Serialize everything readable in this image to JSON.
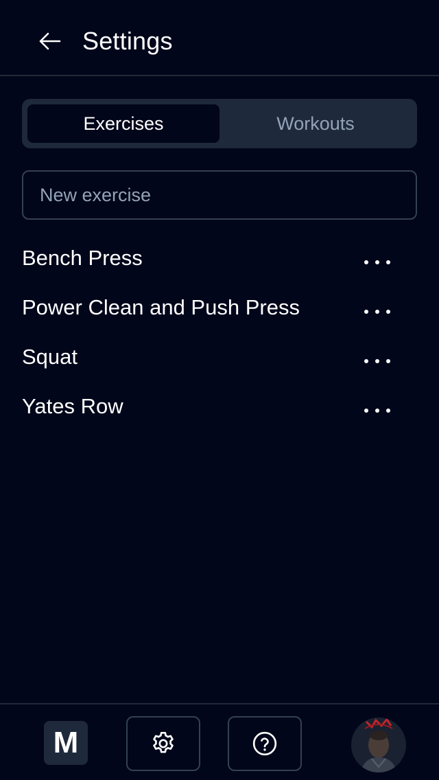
{
  "header": {
    "title": "Settings",
    "back_icon": "arrow-left-icon"
  },
  "tabs": [
    {
      "label": "Exercises",
      "active": true
    },
    {
      "label": "Workouts",
      "active": false
    }
  ],
  "new_exercise": {
    "placeholder": "New exercise",
    "value": ""
  },
  "exercises": [
    {
      "name": "Bench Press",
      "menu_icon": "more-horizontal-icon"
    },
    {
      "name": "Power Clean and Push Press",
      "menu_icon": "more-horizontal-icon"
    },
    {
      "name": "Squat",
      "menu_icon": "more-horizontal-icon"
    },
    {
      "name": "Yates Row",
      "menu_icon": "more-horizontal-icon"
    }
  ],
  "footer": {
    "logo_letter": "M",
    "settings_icon": "gear-icon",
    "help_icon": "help-circle-icon",
    "avatar": "user-avatar"
  },
  "colors": {
    "background": "#02061a",
    "surface": "#1e293b",
    "border": "#334155",
    "text": "#ffffff",
    "muted_text": "#94a3b8"
  }
}
